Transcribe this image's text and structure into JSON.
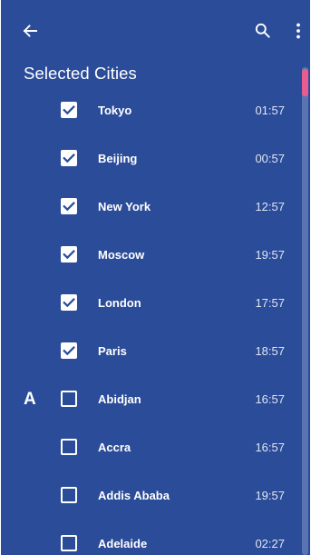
{
  "colors": {
    "background": "#2b4c99",
    "text": "#ffffff",
    "time_text": "#dfe5f2",
    "scrollbar_track": "#5a73b2",
    "scrollbar_thumb": "#e85d8f"
  },
  "toolbar": {
    "back_icon": "arrow-left-icon",
    "search_icon": "search-icon",
    "more_icon": "more-vertical-icon"
  },
  "section": {
    "title": "Selected Cities"
  },
  "cities": [
    {
      "index_letter": "",
      "name": "Tokyo",
      "time": "01:57",
      "checked": true
    },
    {
      "index_letter": "",
      "name": "Beijing",
      "time": "00:57",
      "checked": true
    },
    {
      "index_letter": "",
      "name": "New York",
      "time": "12:57",
      "checked": true
    },
    {
      "index_letter": "",
      "name": "Moscow",
      "time": "19:57",
      "checked": true
    },
    {
      "index_letter": "",
      "name": "London",
      "time": "17:57",
      "checked": true
    },
    {
      "index_letter": "",
      "name": "Paris",
      "time": "18:57",
      "checked": true
    },
    {
      "index_letter": "A",
      "name": "Abidjan",
      "time": "16:57",
      "checked": false
    },
    {
      "index_letter": "",
      "name": "Accra",
      "time": "16:57",
      "checked": false
    },
    {
      "index_letter": "",
      "name": "Addis Ababa",
      "time": "19:57",
      "checked": false
    },
    {
      "index_letter": "",
      "name": "Adelaide",
      "time": "02:27",
      "checked": false
    }
  ],
  "scroll": {
    "position_fraction": 0.0
  }
}
